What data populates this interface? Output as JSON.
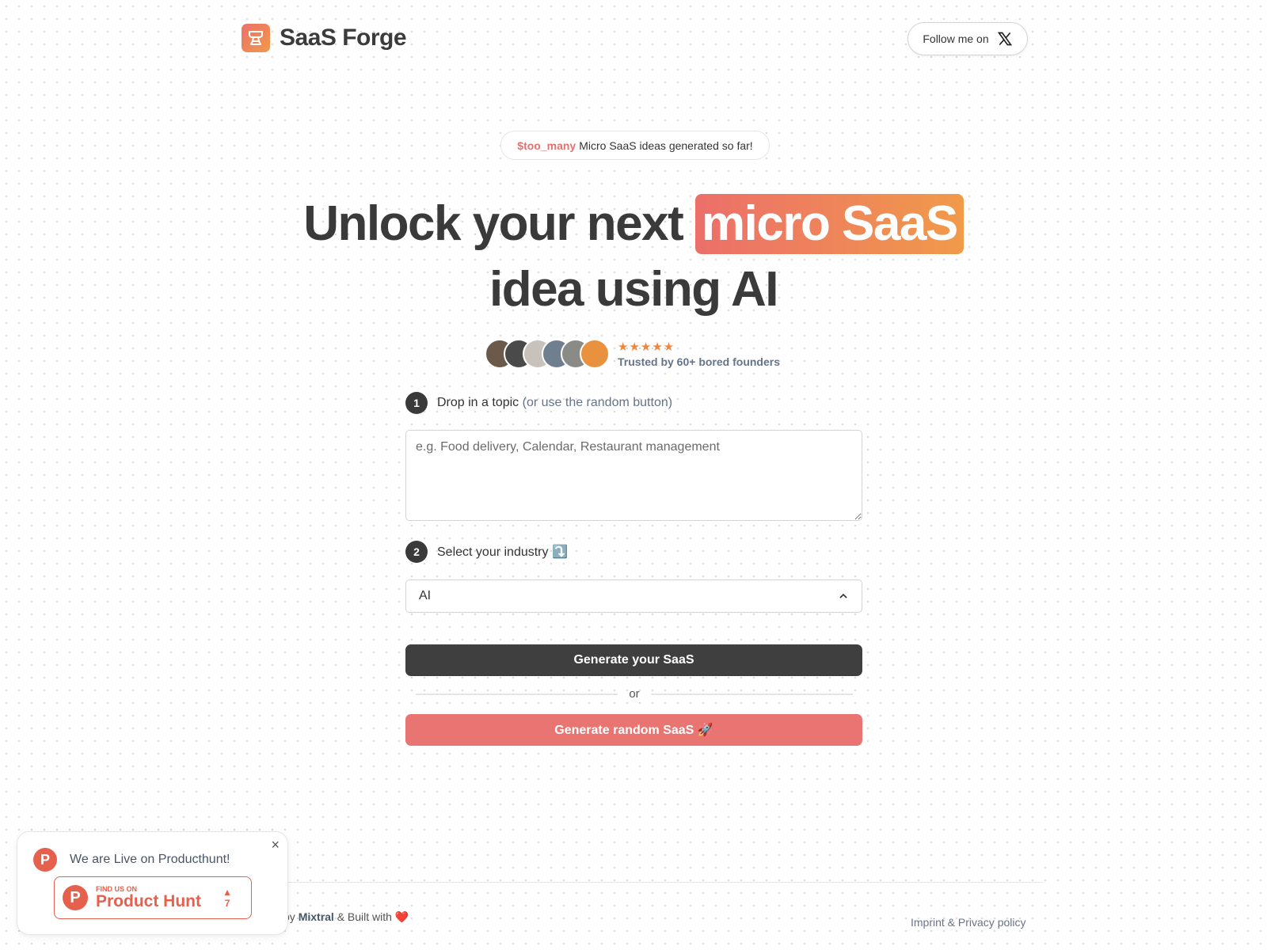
{
  "header": {
    "brand": "SaaS Forge",
    "follow_label": "Follow me on",
    "follow_icon": "x-logo-icon"
  },
  "counter": {
    "variable": "$too_many",
    "text": "Micro SaaS ideas generated so far!"
  },
  "hero": {
    "line1": "Unlock your next",
    "highlight": "micro SaaS",
    "line2": "idea using AI",
    "highlight_colors": [
      "#ec6f6a",
      "#f09a4a"
    ]
  },
  "social_proof": {
    "rating": 5,
    "stars": "★★★★★",
    "text": "Trusted by 60+ bored founders",
    "avatar_count": 6
  },
  "form": {
    "step1": {
      "number": "1",
      "label": "Drop in a topic",
      "hint": "(or use the random button)",
      "placeholder": "e.g. Food delivery, Calendar, Restaurant management"
    },
    "step2": {
      "number": "2",
      "label": "Select your industry",
      "emoji": "⤵️",
      "selected": "AI"
    },
    "generate_label": "Generate your SaaS",
    "or_label": "or",
    "random_label": "Generate random SaaS 🚀"
  },
  "footer": {
    "left_prefix": "by",
    "model": "Mixtral",
    "left_suffix": "& Built with ❤️",
    "right": "Imprint & Privacy policy"
  },
  "popup": {
    "title": "We are Live on Producthunt!",
    "badge_small": "FIND US ON",
    "badge_name": "Product Hunt",
    "votes": "7",
    "close": "×"
  },
  "colors": {
    "accent": "#e87572",
    "dark": "#3f3f3f",
    "producthunt": "#e5604d"
  }
}
